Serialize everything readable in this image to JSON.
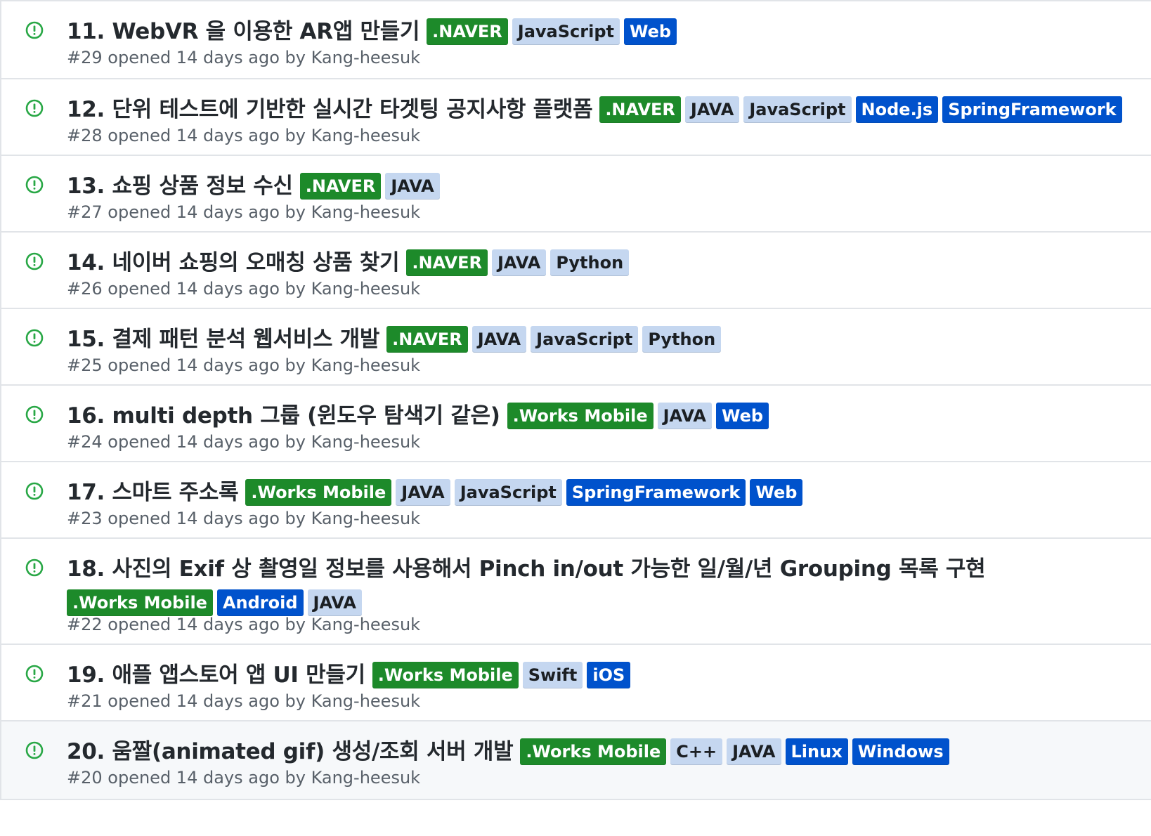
{
  "colors": {
    "open_icon": "#28a745",
    "label_naver_works": "#1d8a2a",
    "label_language": "#c5d7f0",
    "label_platform": "#0052cc"
  },
  "issues": [
    {
      "title": "11. WebVR 을 이용한 AR앱 만들기",
      "meta": "#29 opened 14 days ago by Kang-heesuk",
      "labels": [
        {
          "text": ".NAVER",
          "color": "green"
        },
        {
          "text": "JavaScript",
          "color": "light"
        },
        {
          "text": "Web",
          "color": "blue"
        }
      ]
    },
    {
      "title": "12. 단위 테스트에 기반한 실시간 타겟팅 공지사항 플랫폼",
      "meta": "#28 opened 14 days ago by Kang-heesuk",
      "labels": [
        {
          "text": ".NAVER",
          "color": "green"
        },
        {
          "text": "JAVA",
          "color": "light"
        },
        {
          "text": "JavaScript",
          "color": "light"
        },
        {
          "text": "Node.js",
          "color": "blue"
        },
        {
          "text": "SpringFramework",
          "color": "blue"
        }
      ]
    },
    {
      "title": "13. 쇼핑 상품 정보 수신",
      "meta": "#27 opened 14 days ago by Kang-heesuk",
      "labels": [
        {
          "text": ".NAVER",
          "color": "green"
        },
        {
          "text": "JAVA",
          "color": "light"
        }
      ]
    },
    {
      "title": "14. 네이버 쇼핑의 오매칭 상품 찾기",
      "meta": "#26 opened 14 days ago by Kang-heesuk",
      "labels": [
        {
          "text": ".NAVER",
          "color": "green"
        },
        {
          "text": "JAVA",
          "color": "light"
        },
        {
          "text": "Python",
          "color": "light"
        }
      ]
    },
    {
      "title": "15. 결제 패턴 분석 웹서비스 개발",
      "meta": "#25 opened 14 days ago by Kang-heesuk",
      "labels": [
        {
          "text": ".NAVER",
          "color": "green"
        },
        {
          "text": "JAVA",
          "color": "light"
        },
        {
          "text": "JavaScript",
          "color": "light"
        },
        {
          "text": "Python",
          "color": "light"
        }
      ]
    },
    {
      "title": "16. multi depth 그룹 (윈도우 탐색기 같은)",
      "meta": "#24 opened 14 days ago by Kang-heesuk",
      "labels": [
        {
          "text": ".Works Mobile",
          "color": "green"
        },
        {
          "text": "JAVA",
          "color": "light"
        },
        {
          "text": "Web",
          "color": "blue"
        }
      ]
    },
    {
      "title": "17. 스마트 주소록",
      "meta": "#23 opened 14 days ago by Kang-heesuk",
      "labels": [
        {
          "text": ".Works Mobile",
          "color": "green"
        },
        {
          "text": "JAVA",
          "color": "light"
        },
        {
          "text": "JavaScript",
          "color": "light"
        },
        {
          "text": "SpringFramework",
          "color": "blue"
        },
        {
          "text": "Web",
          "color": "blue"
        }
      ]
    },
    {
      "title": "18. 사진의 Exif 상 촬영일 정보를 사용해서 Pinch in/out 가능한 일/월/년 Grouping 목록 구현",
      "meta": "#22 opened 14 days ago by Kang-heesuk",
      "labels": [
        {
          "text": ".Works Mobile",
          "color": "green"
        },
        {
          "text": "Android",
          "color": "blue"
        },
        {
          "text": "JAVA",
          "color": "light"
        }
      ]
    },
    {
      "title": "19. 애플 앱스토어 앱 UI 만들기",
      "meta": "#21 opened 14 days ago by Kang-heesuk",
      "labels": [
        {
          "text": ".Works Mobile",
          "color": "green"
        },
        {
          "text": "Swift",
          "color": "light"
        },
        {
          "text": "iOS",
          "color": "blue"
        }
      ]
    },
    {
      "title": "20. 움짤(animated gif) 생성/조회 서버 개발",
      "meta": "#20 opened 14 days ago by Kang-heesuk",
      "labels": [
        {
          "text": ".Works Mobile",
          "color": "green"
        },
        {
          "text": "C++",
          "color": "light"
        },
        {
          "text": "JAVA",
          "color": "light"
        },
        {
          "text": "Linux",
          "color": "blue"
        },
        {
          "text": "Windows",
          "color": "blue"
        }
      ]
    }
  ]
}
